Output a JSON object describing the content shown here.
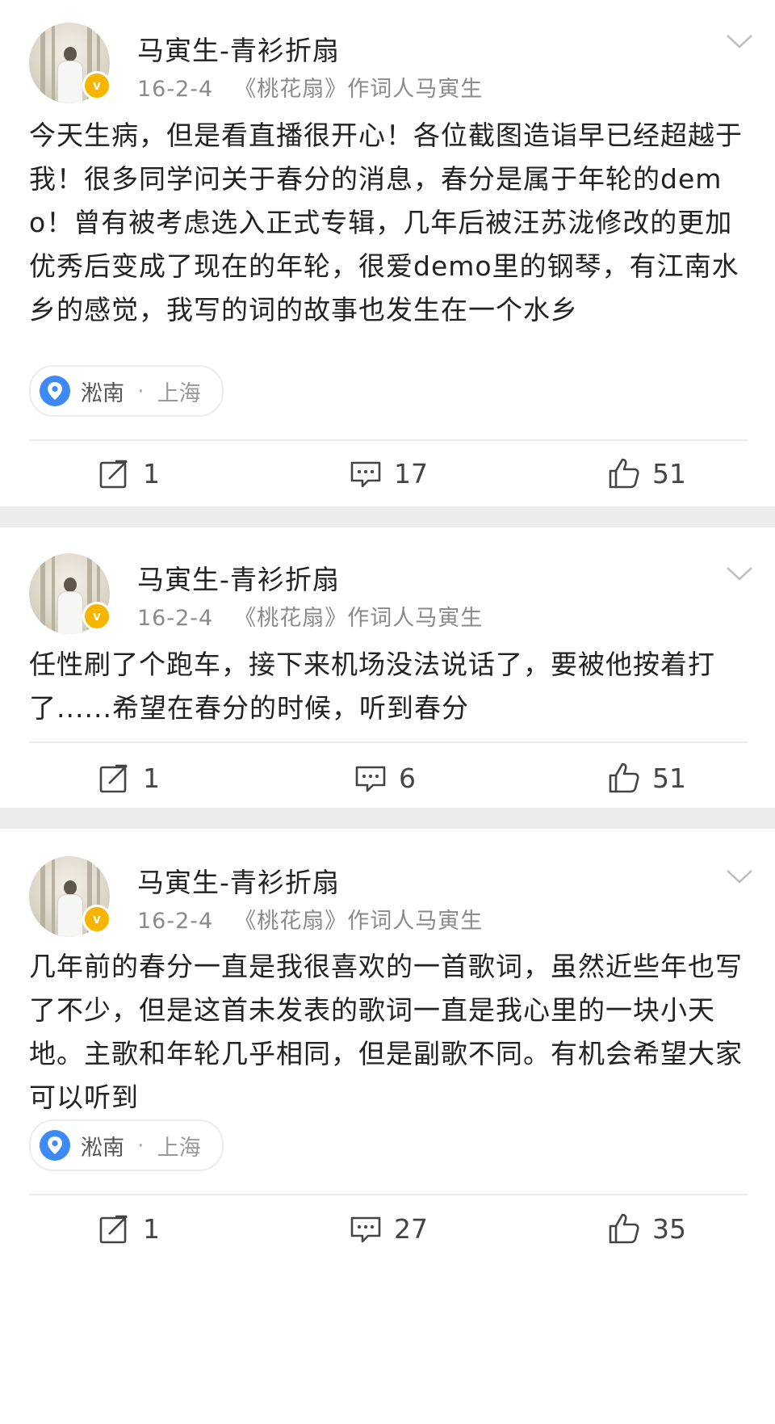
{
  "posts": [
    {
      "author": "马寅生-青衫折扇",
      "date": "16-2-4",
      "source": "《桃花扇》作词人马寅生",
      "text": "今天生病，但是看直播很开心！各位截图造诣早已经超越于我！很多同学问关于春分的消息，春分是属于年轮的demo！曾有被考虑选入正式专辑，几年后被汪苏泷修改的更加优秀后变成了现在的年轮，很爱demo里的钢琴，有江南水乡的感觉，我写的词的故事也发生在一个水乡",
      "location": {
        "place": "淞南",
        "separator": "·",
        "city": "上海"
      },
      "reposts": "1",
      "comments": "17",
      "likes": "51"
    },
    {
      "author": "马寅生-青衫折扇",
      "date": "16-2-4",
      "source": "《桃花扇》作词人马寅生",
      "text": "任性刷了个跑车，接下来机场没法说话了，要被他按着打了......希望在春分的时候，听到春分",
      "reposts": "1",
      "comments": "6",
      "likes": "51"
    },
    {
      "author": "马寅生-青衫折扇",
      "date": "16-2-4",
      "source": "《桃花扇》作词人马寅生",
      "text": "几年前的春分一直是我很喜欢的一首歌词，虽然近些年也写了不少，但是这首未发表的歌词一直是我心里的一块小天地。主歌和年轮几乎相同，但是副歌不同。有机会希望大家可以听到",
      "location": {
        "place": "淞南",
        "separator": "·",
        "city": "上海"
      },
      "reposts": "1",
      "comments": "27",
      "likes": "35"
    }
  ],
  "colors": {
    "background": "#ececec",
    "card": "#ffffff",
    "verified_badge": "#f7b500",
    "location_pin": "#3d8af7",
    "meta_text": "#8a8a8a"
  },
  "icons": {
    "verified": "verified-badge-icon",
    "menu": "chevron-down-icon",
    "location": "location-pin-icon",
    "repost": "repost-icon",
    "comment": "comment-icon",
    "like": "thumbs-up-icon"
  }
}
